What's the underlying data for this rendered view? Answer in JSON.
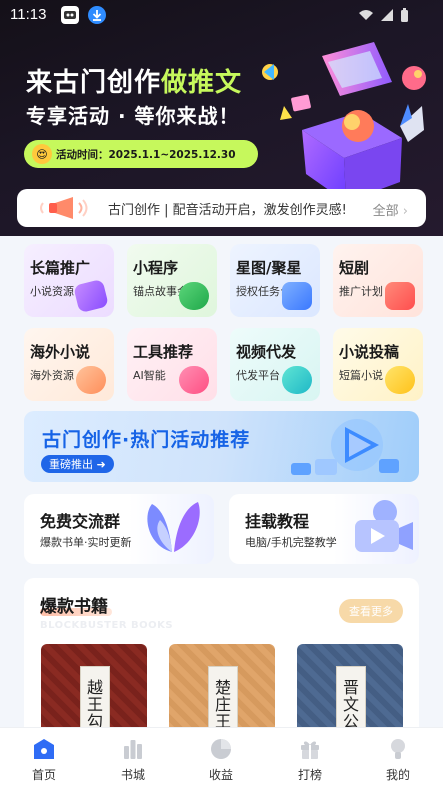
{
  "status_bar": {
    "time": "11:13"
  },
  "hero": {
    "title_part1": "来古门创作",
    "title_part2": "做推文",
    "subtitle": "专享活动 · 等你来战！",
    "date_text": "活动时间：2025.1.1~2025.12.30"
  },
  "notice": {
    "text": "古门创作 | 配音活动开启，激发创作灵感!",
    "all_label": "全部"
  },
  "categories": [
    {
      "label": "长篇推广",
      "sub": "小说资源"
    },
    {
      "label": "小程序",
      "sub": "锚点故事会"
    },
    {
      "label": "星图/聚星",
      "sub": "授权任务台"
    },
    {
      "label": "短剧",
      "sub": "推广计划"
    },
    {
      "label": "海外小说",
      "sub": "海外资源"
    },
    {
      "label": "工具推荐",
      "sub": "AI智能"
    },
    {
      "label": "视频代发",
      "sub": "代发平台"
    },
    {
      "label": "小说投稿",
      "sub": "短篇小说"
    }
  ],
  "promo_banner": {
    "title": "古门创作·热门活动推荐",
    "pill": "重磅推出"
  },
  "cards": [
    {
      "title": "免费交流群",
      "sub": "爆款书单·实时更新"
    },
    {
      "title": "挂载教程",
      "sub": "电脑/手机完整教学"
    }
  ],
  "books_section": {
    "title": "爆款书籍",
    "subtitle_en": "BLOCKBUSTER BOOKS",
    "more_label": "查看更多",
    "books": [
      {
        "cover_title": "越王勾践"
      },
      {
        "cover_title": "楚庄王"
      },
      {
        "cover_title": "晋文公"
      }
    ]
  },
  "tabbar": [
    {
      "label": "首页",
      "icon": "home-icon"
    },
    {
      "label": "书城",
      "icon": "bookstore-icon"
    },
    {
      "label": "收益",
      "icon": "earnings-icon"
    },
    {
      "label": "打榜",
      "icon": "gift-icon"
    },
    {
      "label": "我的",
      "icon": "profile-icon"
    }
  ],
  "colors": {
    "accent": "#2f6cf5",
    "lime": "#c6f85c",
    "hero_bg": "#1c1626"
  }
}
